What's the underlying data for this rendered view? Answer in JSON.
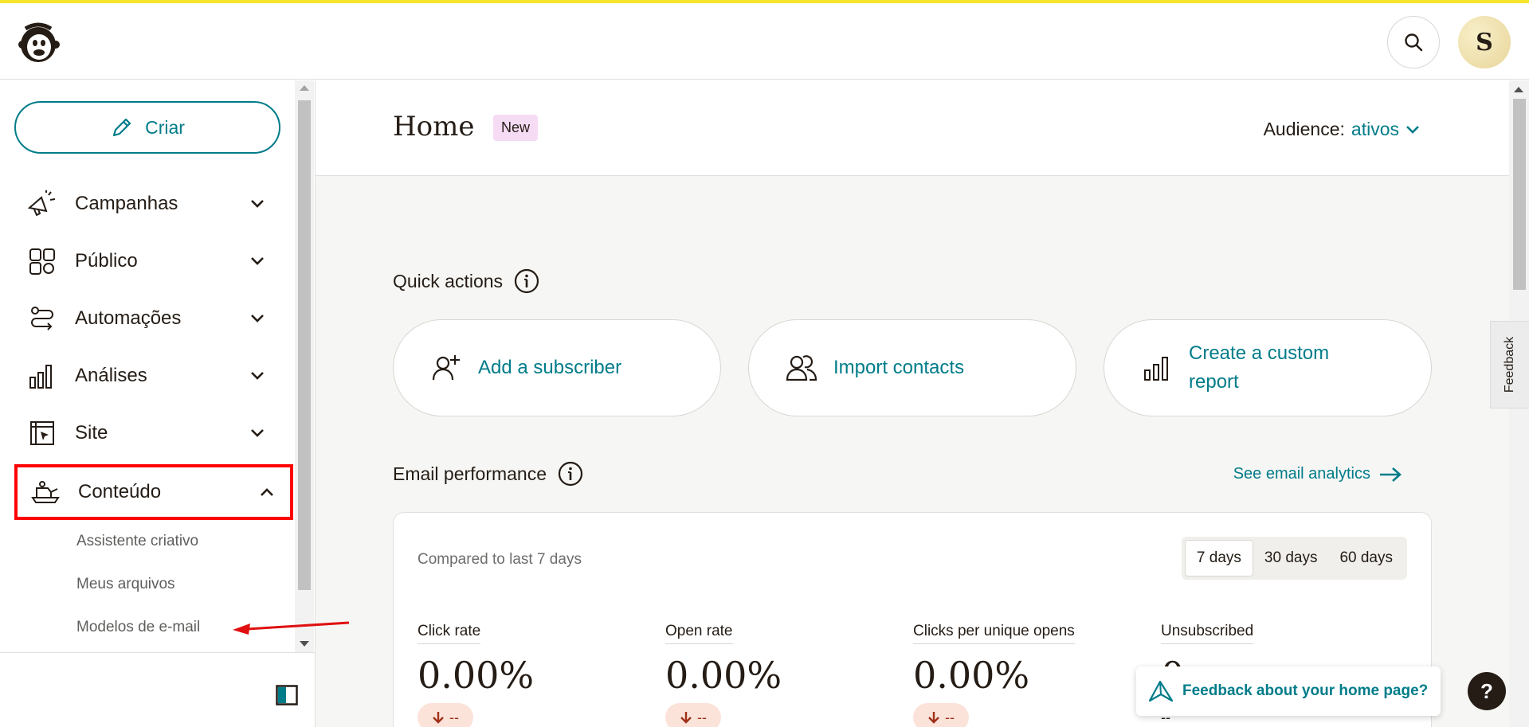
{
  "topbar": {
    "avatar_initial": "S",
    "icons": {
      "logo": "mailchimp-logo",
      "search": "search-icon"
    }
  },
  "sidebar": {
    "create_label": "Criar",
    "items": [
      {
        "label": "Campanhas",
        "icon": "megaphone-icon",
        "expanded": false
      },
      {
        "label": "Público",
        "icon": "audience-icon",
        "expanded": false
      },
      {
        "label": "Automações",
        "icon": "automation-icon",
        "expanded": false
      },
      {
        "label": "Análises",
        "icon": "analytics-icon",
        "expanded": false
      },
      {
        "label": "Site",
        "icon": "website-icon",
        "expanded": false
      },
      {
        "label": "Conteúdo",
        "icon": "content-icon",
        "expanded": true
      }
    ],
    "sub_items": [
      {
        "label": "Assistente criativo"
      },
      {
        "label": "Meus arquivos"
      },
      {
        "label": "Modelos de e-mail"
      }
    ]
  },
  "header": {
    "title": "Home",
    "badge": "New",
    "audience_label": "Audience:",
    "audience_value": "ativos"
  },
  "quick_actions": {
    "title": "Quick actions",
    "cards": [
      {
        "label": "Add a subscriber",
        "icon": "add-user-icon"
      },
      {
        "label": "Import contacts",
        "icon": "contacts-icon"
      },
      {
        "label": "Create a custom report",
        "icon": "bar-chart-icon"
      }
    ]
  },
  "email_performance": {
    "title": "Email performance",
    "see_link": "See email analytics",
    "compared": "Compared to last 7 days",
    "ranges": [
      {
        "label": "7 days",
        "selected": true
      },
      {
        "label": "30 days",
        "selected": false
      },
      {
        "label": "60 days",
        "selected": false
      }
    ],
    "metrics": [
      {
        "label": "Click rate",
        "value": "0.00%",
        "delta": "--"
      },
      {
        "label": "Open rate",
        "value": "0.00%",
        "delta": "--"
      },
      {
        "label": "Clicks per unique opens",
        "value": "0.00%",
        "delta": "--"
      },
      {
        "label": "Unsubscribed",
        "value": "0",
        "delta": "--"
      }
    ]
  },
  "feedback_tab": "Feedback",
  "feedback_pill": "Feedback about your home page?",
  "help": "?",
  "colors": {
    "accent": "#007c89",
    "highlight": "#ff0000",
    "brand_yellow": "#f5e52b"
  }
}
